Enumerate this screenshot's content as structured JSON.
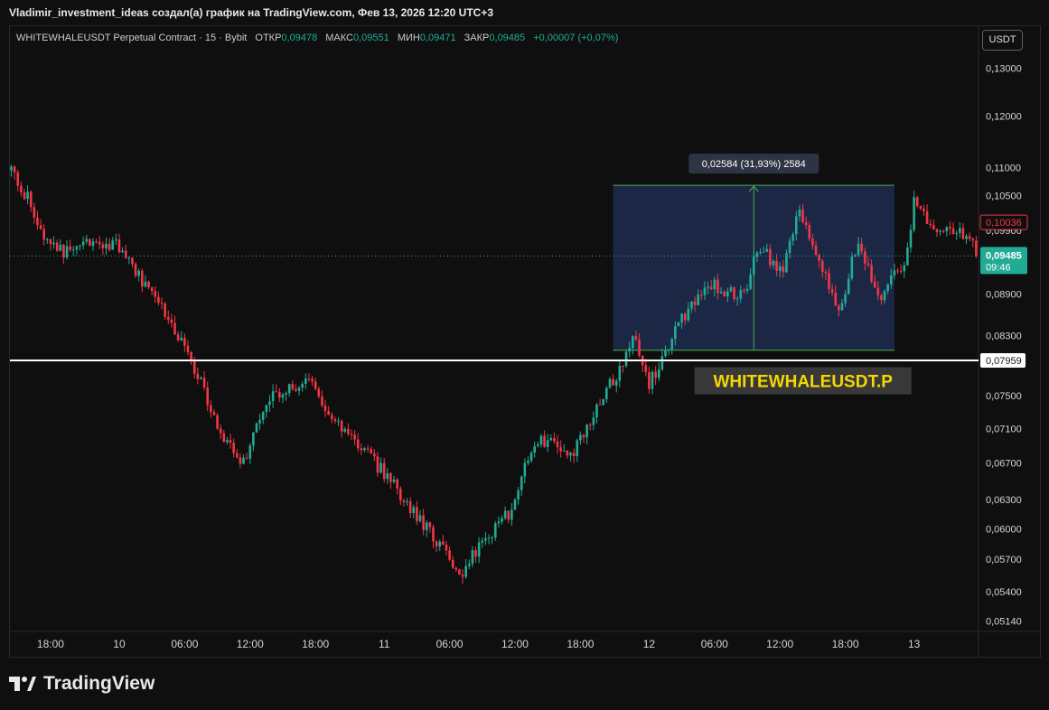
{
  "caption": "Vladimir_investment_ideas создал(а) график на TradingView.com, Фев 13, 2026 12:20 UTC+3",
  "legend": {
    "symbol": "WHITEWHALEUSDT Perpetual Contract · 15 · Bybit",
    "open_label": "ОТКР",
    "open_value": "0,09478",
    "high_label": "МАКС",
    "high_value": "0,09551",
    "low_label": "МИН",
    "low_value": "0,09471",
    "close_label": "ЗАКР",
    "close_value": "0,09485",
    "change": "+0,00007 (+0,07%)"
  },
  "currency_button": "USDT",
  "brand": "TradingView",
  "colors": {
    "up": "#22ab94",
    "down": "#f23645",
    "background": "#0f0f0f",
    "range_box": "#1e2b4f",
    "range_border": "#4caf50",
    "support_line": "#ffffff",
    "annotation_text": "#f5d800"
  },
  "chart_data": {
    "type": "candlestick",
    "scale": "log",
    "ylim": [
      0.0505,
      0.1395
    ],
    "x_tick_labels": [
      "18:00",
      "10",
      "06:00",
      "12:00",
      "18:00",
      "11",
      "06:00",
      "12:00",
      "18:00",
      "12",
      "06:00",
      "12:00",
      "18:00",
      "13"
    ],
    "y_tick_labels": [
      "0,13000",
      "0,12000",
      "0,11000",
      "0,10500",
      "0,09900",
      "0,08900",
      "0,08300",
      "0,07959",
      "0,07500",
      "0,07100",
      "0,06700",
      "0,06300",
      "0,06000",
      "0,05700",
      "0,05400",
      "0,05140"
    ],
    "y_tick_values": [
      0.13,
      0.12,
      0.11,
      0.105,
      0.099,
      0.089,
      0.083,
      0.07959,
      0.075,
      0.071,
      0.067,
      0.063,
      0.06,
      0.057,
      0.054,
      0.0514
    ],
    "x_tick_bars": [
      12,
      33,
      53,
      73,
      93,
      114,
      134,
      154,
      174,
      195,
      215,
      235,
      255,
      276
    ],
    "path": [
      {
        "bar": 0,
        "price": 0.1095
      },
      {
        "bar": 6,
        "price": 0.1035
      },
      {
        "bar": 10,
        "price": 0.0985
      },
      {
        "bar": 16,
        "price": 0.0955
      },
      {
        "bar": 23,
        "price": 0.0975
      },
      {
        "bar": 32,
        "price": 0.0965
      },
      {
        "bar": 44,
        "price": 0.0885
      },
      {
        "bar": 55,
        "price": 0.0795
      },
      {
        "bar": 63,
        "price": 0.0715
      },
      {
        "bar": 70,
        "price": 0.0665
      },
      {
        "bar": 80,
        "price": 0.0755
      },
      {
        "bar": 92,
        "price": 0.0765
      },
      {
        "bar": 100,
        "price": 0.0715
      },
      {
        "bar": 115,
        "price": 0.0655
      },
      {
        "bar": 126,
        "price": 0.0605
      },
      {
        "bar": 137,
        "price": 0.0555
      },
      {
        "bar": 146,
        "price": 0.0595
      },
      {
        "bar": 152,
        "price": 0.0615
      },
      {
        "bar": 160,
        "price": 0.0695
      },
      {
        "bar": 172,
        "price": 0.0685
      },
      {
        "bar": 186,
        "price": 0.0785
      },
      {
        "bar": 190,
        "price": 0.0835
      },
      {
        "bar": 195,
        "price": 0.0765
      },
      {
        "bar": 205,
        "price": 0.0855
      },
      {
        "bar": 214,
        "price": 0.0905
      },
      {
        "bar": 224,
        "price": 0.0885
      },
      {
        "bar": 228,
        "price": 0.0965
      },
      {
        "bar": 236,
        "price": 0.0925
      },
      {
        "bar": 241,
        "price": 0.1025
      },
      {
        "bar": 246,
        "price": 0.0955
      },
      {
        "bar": 253,
        "price": 0.0865
      },
      {
        "bar": 259,
        "price": 0.0975
      },
      {
        "bar": 265,
        "price": 0.0885
      },
      {
        "bar": 273,
        "price": 0.0935
      },
      {
        "bar": 276,
        "price": 0.1035
      },
      {
        "bar": 281,
        "price": 0.0995
      },
      {
        "bar": 289,
        "price": 0.0985
      },
      {
        "bar": 295,
        "price": 0.0978
      }
    ],
    "last_price": 0.09485,
    "range_measure": {
      "label": "0,02584 (31,93%) 2584",
      "from_bar": 184,
      "to_bar": 270,
      "low": 0.08096,
      "high": 0.1068,
      "arrow_bar": 227
    },
    "support_line": {
      "price": 0.07959,
      "label": "0,07959"
    },
    "marker_line": {
      "price": 0.10036,
      "label": "0,10036"
    },
    "last_price_label": {
      "price": "0,09485",
      "countdown": "09:46"
    },
    "annotation": "WHITEWHALEUSDT.P"
  }
}
